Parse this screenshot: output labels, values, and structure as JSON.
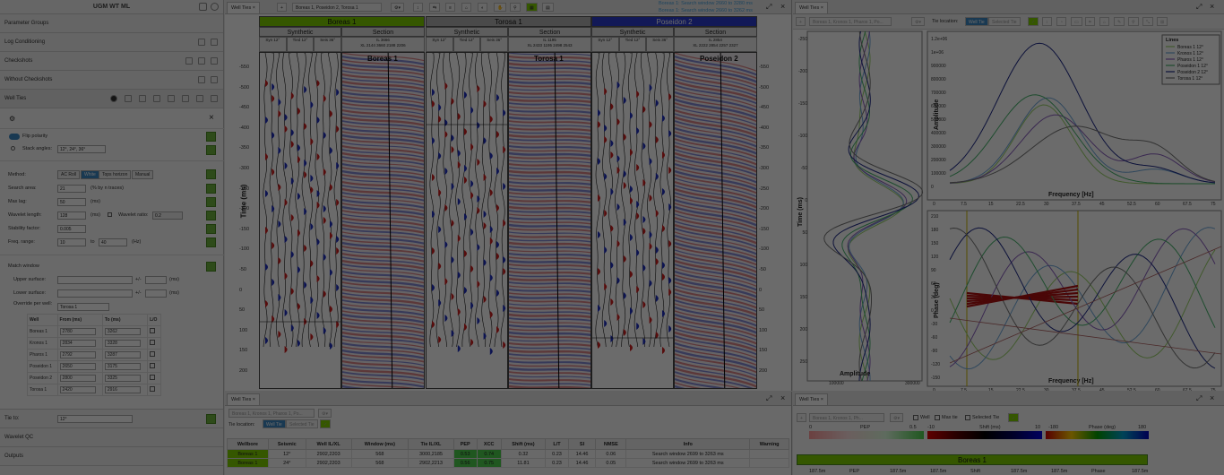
{
  "app": {
    "title": "UGM WT ML"
  },
  "sidebar": {
    "sections": [
      "Parameter Groups",
      "Log Conditioning",
      "Checkshots",
      "Without Checkshots",
      "Well Ties",
      "Tie to:",
      "Wavelet QC",
      "Outputs"
    ],
    "flip_polarity": "Flip polarity",
    "stack_angles_label": "Stack angles:",
    "stack_angles_value": "12°, 24°, 36°",
    "method_label": "Method:",
    "methods": [
      "AC Roll",
      "White",
      "Tops horizon",
      "Manual"
    ],
    "search_area_label": "Search area:",
    "search_area_value": "21",
    "search_area_unit": "(% by n traces)",
    "max_lag_label": "Max lag:",
    "max_lag_value": "50",
    "max_lag_unit": "(ms)",
    "wavelet_length_label": "Wavelet length:",
    "wavelet_length_value": "128",
    "wavelet_length_unit": "(ms)",
    "wavelet_ratio_label": "Wavelet ratio:",
    "wavelet_ratio_value": "0.2",
    "stability_label": "Stability factor:",
    "stability_value": "0.005",
    "freq_label": "Freq. range:",
    "freq_from": "10",
    "freq_to_label": "to",
    "freq_to": "40",
    "freq_unit": "(Hz)",
    "match_window": "Match window",
    "upper_surface": "Upper surface:",
    "lower_surface": "Lower surface:",
    "pm": "+/-",
    "pm_unit": "(ms)",
    "override_label": "Override per well:",
    "override_value": "Torosa 1",
    "table_headers": [
      "Well",
      "From (ms)",
      "To (ms)",
      "L/O"
    ],
    "table_rows": [
      [
        "Boreas 1",
        "2780",
        "3262"
      ],
      [
        "Kronos 1",
        "2834",
        "3328"
      ],
      [
        "Pharos 1",
        "2792",
        "3287"
      ],
      [
        "Poseidon 1",
        "2650",
        "3175"
      ],
      [
        "Poseidon 2",
        "2800",
        "3325"
      ],
      [
        "Torosa 1",
        "2420",
        "2916"
      ]
    ],
    "tie_to_value": "12°"
  },
  "center": {
    "tab": "Well Ties",
    "wells_dropdown": "Boreas 1, Poseidon 2, Torosa 1",
    "status_line1": "Boreas 1: Search window 2660 to 3280 ms",
    "status_line2": "Boreas 1: Search window 2660 to 3262 ms",
    "ylabel": "Time (ms)",
    "panels": [
      {
        "name": "Boreas 1",
        "color": "#7fd000",
        "synthetic": "Synthetic",
        "section": "Section",
        "overlay": "Boreas 1",
        "iline": "IL 3666",
        "xline": "XL 2144",
        "sect_hdr": "3660 2188 2206"
      },
      {
        "name": "Torosa 1",
        "color": "#b0b0b0",
        "synthetic": "Synthetic",
        "section": "Section",
        "overlay": "Torosa 1",
        "iline": "IL 1195",
        "xline": "XL 2433",
        "sect_hdr": "1195 2498 2543"
      },
      {
        "name": "Poseidon 2",
        "color": "#2a3bd0",
        "synthetic": "Synthetic",
        "section": "Section",
        "overlay": "Poseidon 2",
        "iline": "IL 2854",
        "xline": "XL 2222",
        "sect_hdr": "2854 2257 2327"
      }
    ],
    "syn_cols": [
      "Syn 12°",
      "Tied 12°",
      "Seis 36°"
    ],
    "left_ticks": [
      "-550",
      "-500",
      "-450",
      "-400",
      "-350",
      "-300",
      "-250",
      "-200",
      "-150",
      "-100",
      "-50",
      "0",
      "50",
      "100",
      "150",
      "200"
    ],
    "right_ticks": [
      "-550",
      "-500",
      "-450",
      "-400",
      "-350",
      "-300",
      "-250",
      "-200",
      "-150",
      "-100",
      "-50",
      "0",
      "50",
      "100",
      "150",
      "200"
    ]
  },
  "right": {
    "tab": "Well Ties",
    "dropdown": "Boreas 1, Kronos 1, Pharos 1, Po...",
    "tie_location": "Tie location:",
    "well_tie_btn": "Well Tie",
    "selected_tie_btn": "Selected Tie",
    "time_label": "Time (ms)",
    "amp_label": "Amplitude",
    "amp_ticks": [
      "100000",
      "300000"
    ],
    "amplitude_ylabel": "Amplitude",
    "freq_label": "Frequency [Hz]",
    "phase_label": "Phase (deg)",
    "freq_ticks": [
      "0",
      "7.5",
      "15",
      "22.5",
      "30",
      "37.5",
      "45",
      "52.5",
      "60",
      "67.5",
      "75"
    ],
    "amp_y_ticks": [
      "1.2e+06",
      "1e+06",
      "900000",
      "800000",
      "700000",
      "600000",
      "500000",
      "400000",
      "300000",
      "200000",
      "100000",
      "0"
    ],
    "phase_y_ticks": [
      "210",
      "180",
      "150",
      "120",
      "90",
      "60",
      "30",
      "0",
      "-30",
      "-60",
      "-90",
      "-120",
      "-150"
    ],
    "time_ticks": [
      "-250",
      "-200",
      "-150",
      "-100",
      "-50",
      "0",
      "50",
      "100",
      "150",
      "200",
      "250"
    ],
    "legend_title": "Lines",
    "legend": [
      {
        "name": "Boreas 1 12°",
        "color": "#9ad36a"
      },
      {
        "name": "Kronos 1 12°",
        "color": "#6fa8dc"
      },
      {
        "name": "Pharos 1 12°",
        "color": "#8a5fbf"
      },
      {
        "name": "Poseidon 1 12°",
        "color": "#48b56e"
      },
      {
        "name": "Poseidon 2 12°",
        "color": "#1e2a8a"
      },
      {
        "name": "Torosa 1 12°",
        "color": "#777777"
      }
    ]
  },
  "bottom": {
    "tab": "Well Ties",
    "dropdown": "Boreas 1, Kronos 1, Pharos 1, Po...",
    "tie_location": "Tie location:",
    "well_tie_btn": "Well Tie",
    "selected_tie_btn": "Selected Tie",
    "headers": [
      "Wellbore",
      "Seismic",
      "Well IL/XL",
      "Window (ms)",
      "Tie IL/XL",
      "PEP",
      "XCC",
      "Shift (ms)",
      "L/T",
      "SI",
      "NMSE",
      "Info",
      "Warning"
    ],
    "rows": [
      [
        "Boreas 1",
        "12°",
        "2902,2203",
        "568",
        "3000,2185",
        "0.53",
        "0.74",
        "0.32",
        "0.23",
        "14.46",
        "0.06",
        "Search window 2699 to 3263 ms",
        ""
      ],
      [
        "Boreas 1",
        "24°",
        "2902,2203",
        "568",
        "2902,2213",
        "0.56",
        "0.75",
        "11.81",
        "0.23",
        "14.46",
        "0.05",
        "Search window 2699 to 3263 ms",
        ""
      ]
    ]
  },
  "bottom_right": {
    "tab": "Well Ties",
    "dropdown": "Boreas 1, Kronos 1, Ph...",
    "well_chk": "Well",
    "max_tie_chk": "Max tie",
    "selected_tie_chk": "Selected Tie",
    "pep_label": "PEP",
    "pep_range": [
      "0",
      "0.5"
    ],
    "shift_label": "Shift (ms)",
    "shift_range": [
      "-10",
      "10"
    ],
    "phase_label": "Phase (deg)",
    "phase_range": [
      "-180",
      "180"
    ],
    "banner": "Boreas 1",
    "col_labels": [
      "187.5m",
      "PEP",
      "187.5m",
      "187.5m",
      "Shift",
      "187.5m",
      "187.5m",
      "Phase",
      "187.5m"
    ]
  }
}
